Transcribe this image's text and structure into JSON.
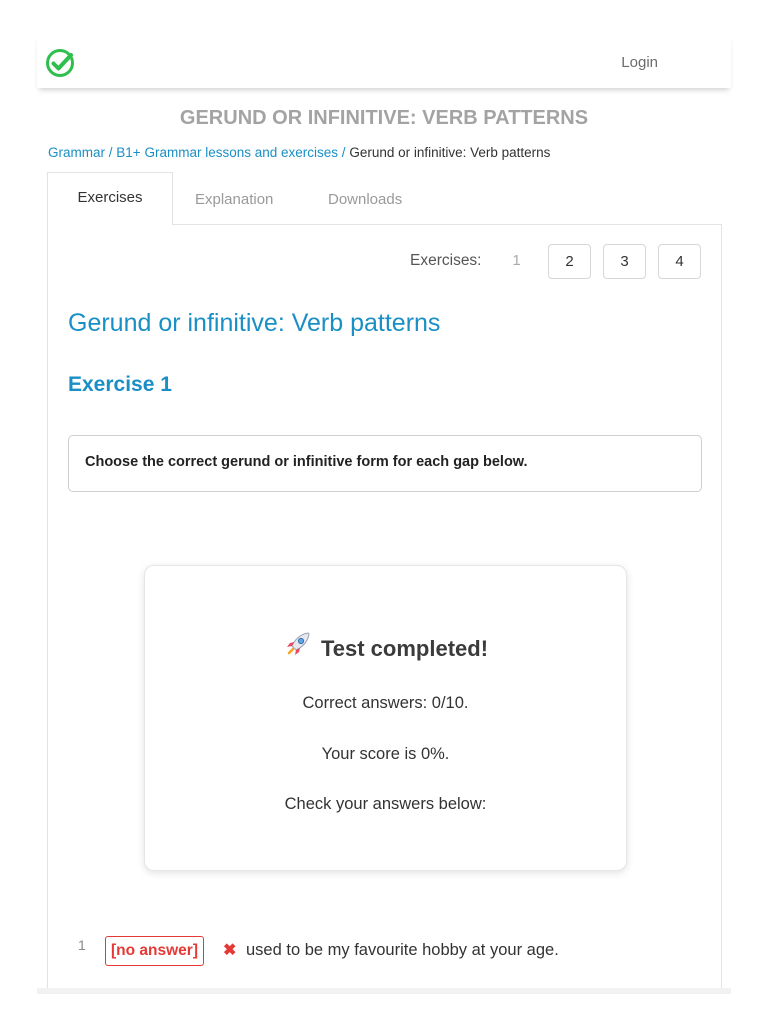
{
  "header": {
    "login_label": "Login",
    "brand_color": "#2fbf4c"
  },
  "page": {
    "title": "GERUND OR INFINITIVE: VERB PATTERNS"
  },
  "breadcrumb": {
    "items": [
      "Grammar",
      "B1+ Grammar lessons and exercises"
    ],
    "current": "Gerund or infinitive: Verb patterns",
    "separator": "/"
  },
  "tabs": [
    {
      "label": "Exercises",
      "active": true
    },
    {
      "label": "Explanation",
      "active": false
    },
    {
      "label": "Downloads",
      "active": false
    }
  ],
  "pager": {
    "label": "Exercises:",
    "pages": [
      "1",
      "2",
      "3",
      "4"
    ],
    "current": "1"
  },
  "main": {
    "heading": "Gerund or infinitive: Verb patterns",
    "exercise_heading": "Exercise 1",
    "instruction": "Choose the correct gerund or infinitive form for each gap below."
  },
  "result": {
    "icon": "rocket-icon",
    "title": "Test completed!",
    "correct_answers": "Correct answers: 0/10.",
    "score": "Your score is 0%.",
    "check": "Check your answers below:"
  },
  "questions": [
    {
      "number": "1",
      "answer": "[no answer]",
      "status_icon": "cross-icon",
      "text": "used to be my favourite hobby at your age."
    }
  ],
  "colors": {
    "accent": "#1a8fc5",
    "error": "#e53935",
    "title_gray": "#a3a3a3"
  }
}
